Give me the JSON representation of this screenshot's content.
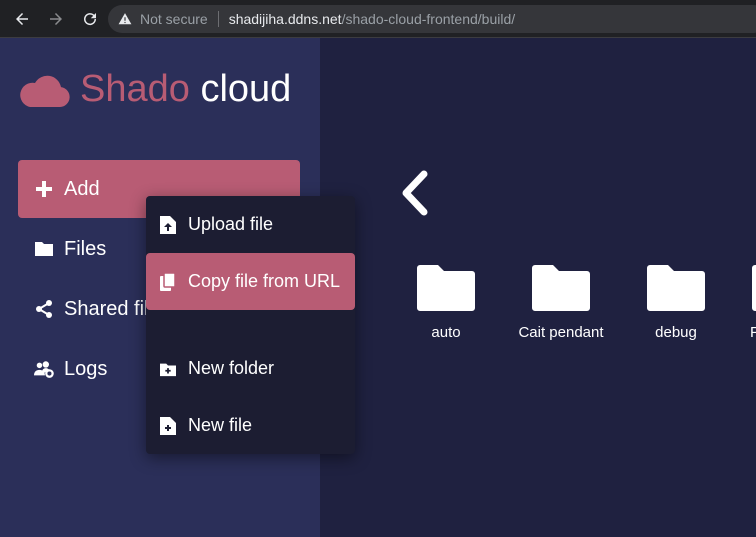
{
  "browser": {
    "security": "Not secure",
    "url_host": "shadijiha.ddns.net",
    "url_path": "/shado-cloud-frontend/build/"
  },
  "app": {
    "logo_part1": "Shado",
    "logo_part2": "cloud"
  },
  "sidebar": {
    "items": [
      {
        "label": "Add",
        "icon": "plus-icon"
      },
      {
        "label": "Files",
        "icon": "folder-icon"
      },
      {
        "label": "Shared files",
        "icon": "share-icon"
      },
      {
        "label": "Logs",
        "icon": "users-cog-icon"
      }
    ]
  },
  "dropdown": {
    "items": [
      {
        "label": "Upload file",
        "icon": "file-upload-icon"
      },
      {
        "label": "Copy file from URL",
        "icon": "copy-icon"
      },
      {
        "label": "New folder",
        "icon": "folder-plus-icon"
      },
      {
        "label": "New file",
        "icon": "file-plus-icon"
      }
    ]
  },
  "folders": [
    {
      "name": "auto"
    },
    {
      "name": "Cait pendant"
    },
    {
      "name": "debug"
    },
    {
      "name": "P"
    }
  ],
  "colors": {
    "accent": "#b85c74",
    "sidebar_bg": "#2b2f59",
    "main_bg": "#1f2140",
    "menu_bg": "#1c1d32"
  }
}
